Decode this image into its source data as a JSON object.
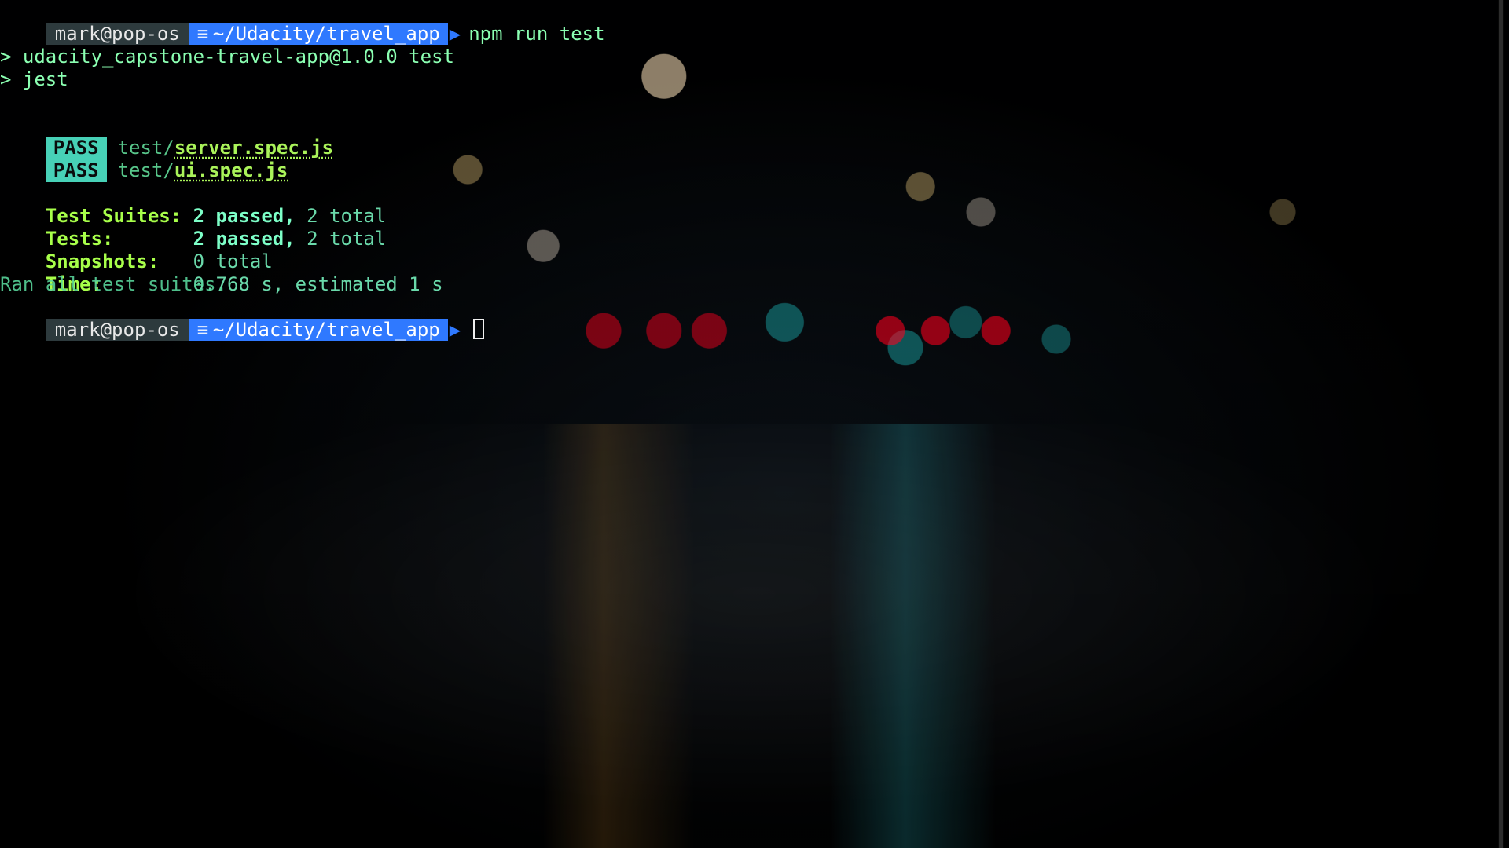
{
  "prompt": {
    "user_host": "mark@pop-os",
    "path": "~/Udacity/travel_app",
    "icon": "≡",
    "arrow": "▶"
  },
  "session": {
    "command": "npm run test",
    "script_line_1": "> udacity_capstone-travel-app@1.0.0 test",
    "script_line_2": "> jest",
    "results": [
      {
        "badge": "PASS",
        "prefix": "test/",
        "file": "server.spec.js"
      },
      {
        "badge": "PASS",
        "prefix": "test/",
        "file": "ui.spec.js"
      }
    ],
    "summary": {
      "test_suites_label": "Test Suites:",
      "test_suites_passed_num": "2",
      "test_suites_passed_word": "passed,",
      "test_suites_total": "2 total",
      "tests_label": "Tests:",
      "tests_passed_num": "2",
      "tests_passed_word": "passed,",
      "tests_total": "2 total",
      "snapshots_label": "Snapshots:",
      "snapshots_total": "0 total",
      "time_label": "Time:",
      "time_value": "0.768 s, estimated 1 s",
      "ran_all": "Ran all test suites."
    }
  }
}
